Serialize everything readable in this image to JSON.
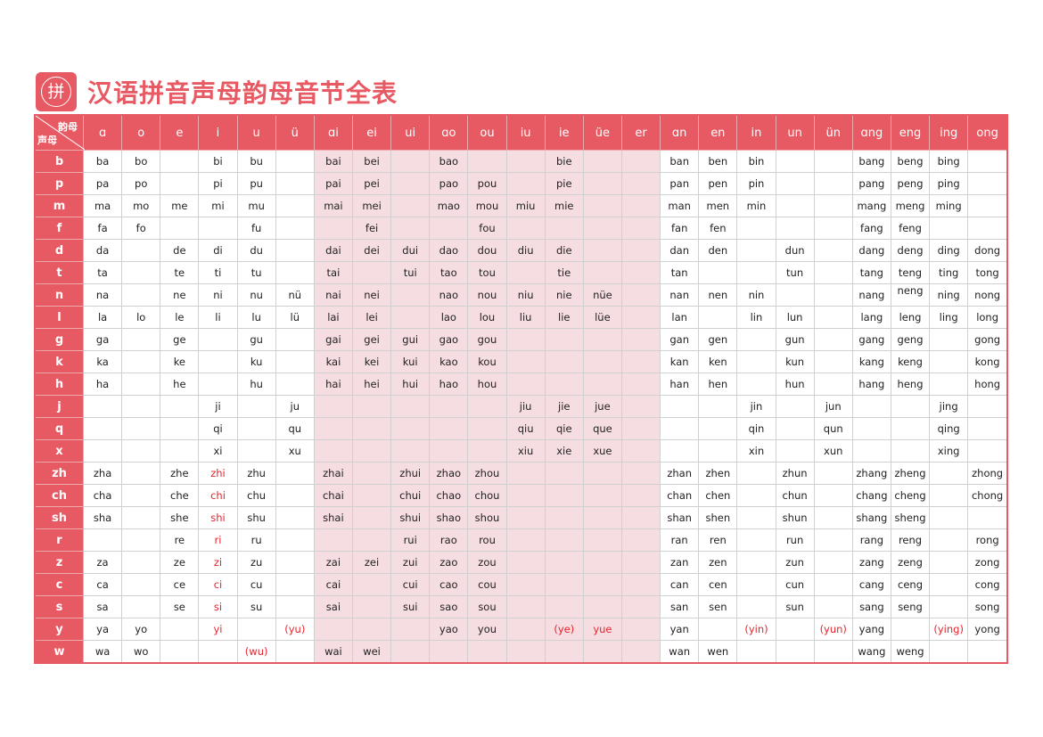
{
  "page": {
    "title": "汉语拼音声母韵母音节全表",
    "logo_char": "拼"
  },
  "table": {
    "corner_top": "韵母",
    "corner_bottom": "声母",
    "finals": [
      "ɑ",
      "o",
      "e",
      "i",
      "u",
      "ü",
      "ɑi",
      "ei",
      "ui",
      "ɑo",
      "ou",
      "iu",
      "ie",
      "üe",
      "er",
      "ɑn",
      "en",
      "in",
      "un",
      "ün",
      "ɑng",
      "eng",
      "ing",
      "ong"
    ],
    "shaded_final_range": [
      "ɑi",
      "er"
    ],
    "colors": {
      "accent": "#e85a63",
      "shaded_cell": "#f6dde1",
      "highlight_text": "#e8242c",
      "grid": "#d0d0d0"
    },
    "rows": [
      {
        "initial": "b",
        "cells": [
          "ba",
          "bo",
          "",
          "bi",
          "bu",
          "",
          "bai",
          "bei",
          "",
          "bao",
          "",
          "",
          "bie",
          "",
          "",
          "ban",
          "ben",
          "bin",
          "",
          "",
          "bang",
          "beng",
          "bing",
          ""
        ]
      },
      {
        "initial": "p",
        "cells": [
          "pa",
          "po",
          "",
          "pi",
          "pu",
          "",
          "pai",
          "pei",
          "",
          "pao",
          "pou",
          "",
          "pie",
          "",
          "",
          "pan",
          "pen",
          "pin",
          "",
          "",
          "pang",
          "peng",
          "ping",
          ""
        ]
      },
      {
        "initial": "m",
        "cells": [
          "ma",
          "mo",
          "me",
          "mi",
          "mu",
          "",
          "mai",
          "mei",
          "",
          "mao",
          "mou",
          "miu",
          "mie",
          "",
          "",
          "man",
          "men",
          "min",
          "",
          "",
          "mang",
          "meng",
          "ming",
          ""
        ]
      },
      {
        "initial": "f",
        "cells": [
          "fa",
          "fo",
          "",
          "",
          "fu",
          "",
          "",
          "fei",
          "",
          "",
          "fou",
          "",
          "",
          "",
          "",
          "fan",
          "fen",
          "",
          "",
          "",
          "fang",
          "feng",
          "",
          ""
        ]
      },
      {
        "initial": "d",
        "cells": [
          "da",
          "",
          "de",
          "di",
          "du",
          "",
          "dai",
          "dei",
          "dui",
          "dao",
          "dou",
          "diu",
          "die",
          "",
          "",
          "dan",
          "den",
          "",
          "dun",
          "",
          "dang",
          "deng",
          "ding",
          "dong"
        ]
      },
      {
        "initial": "t",
        "cells": [
          "ta",
          "",
          "te",
          "ti",
          "tu",
          "",
          "tai",
          "",
          "tui",
          "tao",
          "tou",
          "",
          "tie",
          "",
          "",
          "tan",
          "",
          "",
          "tun",
          "",
          "tang",
          "teng",
          "ting",
          "tong"
        ]
      },
      {
        "initial": "n",
        "cells": [
          "na",
          "",
          "ne",
          "ni",
          "nu",
          "nü",
          "nai",
          "nei",
          "",
          "nao",
          "nou",
          "niu",
          "nie",
          "nüe",
          "",
          "nan",
          "nen",
          "nin",
          "",
          "",
          "nang",
          "neng",
          "ning",
          "nong"
        ]
      },
      {
        "initial": "l",
        "cells": [
          "la",
          "lo",
          "le",
          "li",
          "lu",
          "lü",
          "lai",
          "lei",
          "",
          "lao",
          "lou",
          "liu",
          "lie",
          "lüe",
          "",
          "lan",
          "",
          "lin",
          "lun",
          "",
          "lang",
          "leng",
          "ling",
          "long"
        ]
      },
      {
        "initial": "g",
        "cells": [
          "ga",
          "",
          "ge",
          "",
          "gu",
          "",
          "gai",
          "gei",
          "gui",
          "gao",
          "gou",
          "",
          "",
          "",
          "",
          "gan",
          "gen",
          "",
          "gun",
          "",
          "gang",
          "geng",
          "",
          "gong"
        ]
      },
      {
        "initial": "k",
        "cells": [
          "ka",
          "",
          "ke",
          "",
          "ku",
          "",
          "kai",
          "kei",
          "kui",
          "kao",
          "kou",
          "",
          "",
          "",
          "",
          "kan",
          "ken",
          "",
          "kun",
          "",
          "kang",
          "keng",
          "",
          "kong"
        ]
      },
      {
        "initial": "h",
        "cells": [
          "ha",
          "",
          "he",
          "",
          "hu",
          "",
          "hai",
          "hei",
          "hui",
          "hao",
          "hou",
          "",
          "",
          "",
          "",
          "han",
          "hen",
          "",
          "hun",
          "",
          "hang",
          "heng",
          "",
          "hong"
        ]
      },
      {
        "initial": "j",
        "cells": [
          "",
          "",
          "",
          "ji",
          "",
          "ju",
          "",
          "",
          "",
          "",
          "",
          "jiu",
          "jie",
          "jue",
          "",
          "",
          "",
          "jin",
          "",
          "jun",
          "",
          "",
          "jing",
          ""
        ]
      },
      {
        "initial": "q",
        "cells": [
          "",
          "",
          "",
          "qi",
          "",
          "qu",
          "",
          "",
          "",
          "",
          "",
          "qiu",
          "qie",
          "que",
          "",
          "",
          "",
          "qin",
          "",
          "qun",
          "",
          "",
          "qing",
          ""
        ]
      },
      {
        "initial": "x",
        "cells": [
          "",
          "",
          "",
          "xi",
          "",
          "xu",
          "",
          "",
          "",
          "",
          "",
          "xiu",
          "xie",
          "xue",
          "",
          "",
          "",
          "xin",
          "",
          "xun",
          "",
          "",
          "xing",
          ""
        ]
      },
      {
        "initial": "zh",
        "cells": [
          "zha",
          "",
          "zhe",
          "zhi",
          "zhu",
          "",
          "zhai",
          "",
          "zhui",
          "zhao",
          "zhou",
          "",
          "",
          "",
          "",
          "zhan",
          "zhen",
          "",
          "zhun",
          "",
          "zhang",
          "zheng",
          "",
          "zhong"
        ]
      },
      {
        "initial": "ch",
        "cells": [
          "cha",
          "",
          "che",
          "chi",
          "chu",
          "",
          "chai",
          "",
          "chui",
          "chao",
          "chou",
          "",
          "",
          "",
          "",
          "chan",
          "chen",
          "",
          "chun",
          "",
          "chang",
          "cheng",
          "",
          "chong"
        ]
      },
      {
        "initial": "sh",
        "cells": [
          "sha",
          "",
          "she",
          "shi",
          "shu",
          "",
          "shai",
          "",
          "shui",
          "shao",
          "shou",
          "",
          "",
          "",
          "",
          "shan",
          "shen",
          "",
          "shun",
          "",
          "shang",
          "sheng",
          "",
          ""
        ]
      },
      {
        "initial": "r",
        "cells": [
          "",
          "",
          "re",
          "ri",
          "ru",
          "",
          "",
          "",
          "rui",
          "rao",
          "rou",
          "",
          "",
          "",
          "",
          "ran",
          "ren",
          "",
          "run",
          "",
          "rang",
          "reng",
          "",
          "rong"
        ]
      },
      {
        "initial": "z",
        "cells": [
          "za",
          "",
          "ze",
          "zi",
          "zu",
          "",
          "zai",
          "zei",
          "zui",
          "zao",
          "zou",
          "",
          "",
          "",
          "",
          "zan",
          "zen",
          "",
          "zun",
          "",
          "zang",
          "zeng",
          "",
          "zong"
        ]
      },
      {
        "initial": "c",
        "cells": [
          "ca",
          "",
          "ce",
          "ci",
          "cu",
          "",
          "cai",
          "",
          "cui",
          "cao",
          "cou",
          "",
          "",
          "",
          "",
          "can",
          "cen",
          "",
          "cun",
          "",
          "cang",
          "ceng",
          "",
          "cong"
        ]
      },
      {
        "initial": "s",
        "cells": [
          "sa",
          "",
          "se",
          "si",
          "su",
          "",
          "sai",
          "",
          "sui",
          "sao",
          "sou",
          "",
          "",
          "",
          "",
          "san",
          "sen",
          "",
          "sun",
          "",
          "sang",
          "seng",
          "",
          "song"
        ]
      },
      {
        "initial": "y",
        "cells": [
          "ya",
          "yo",
          "",
          "yi",
          "",
          "(yu)",
          "",
          "",
          "",
          "yao",
          "you",
          "",
          "(ye)",
          "yue",
          "",
          "yan",
          "",
          "(yin)",
          "",
          "(yun)",
          "yang",
          "",
          "(ying)",
          "yong"
        ]
      },
      {
        "initial": "w",
        "cells": [
          "wa",
          "wo",
          "",
          "",
          "(wu)",
          "",
          "wai",
          "wei",
          "",
          "",
          "",
          "",
          "",
          "",
          "",
          "wan",
          "wen",
          "",
          "",
          "",
          "wang",
          "weng",
          "",
          ""
        ]
      }
    ],
    "highlighted_cells": [
      [
        14,
        3
      ],
      [
        15,
        3
      ],
      [
        16,
        3
      ],
      [
        17,
        3
      ],
      [
        18,
        3
      ],
      [
        19,
        3
      ],
      [
        20,
        3
      ],
      [
        21,
        3
      ],
      [
        21,
        5
      ],
      [
        21,
        12
      ],
      [
        21,
        13
      ],
      [
        21,
        17
      ],
      [
        21,
        19
      ],
      [
        21,
        22
      ],
      [
        22,
        4
      ]
    ],
    "raised_cells": [
      [
        6,
        21
      ]
    ]
  }
}
